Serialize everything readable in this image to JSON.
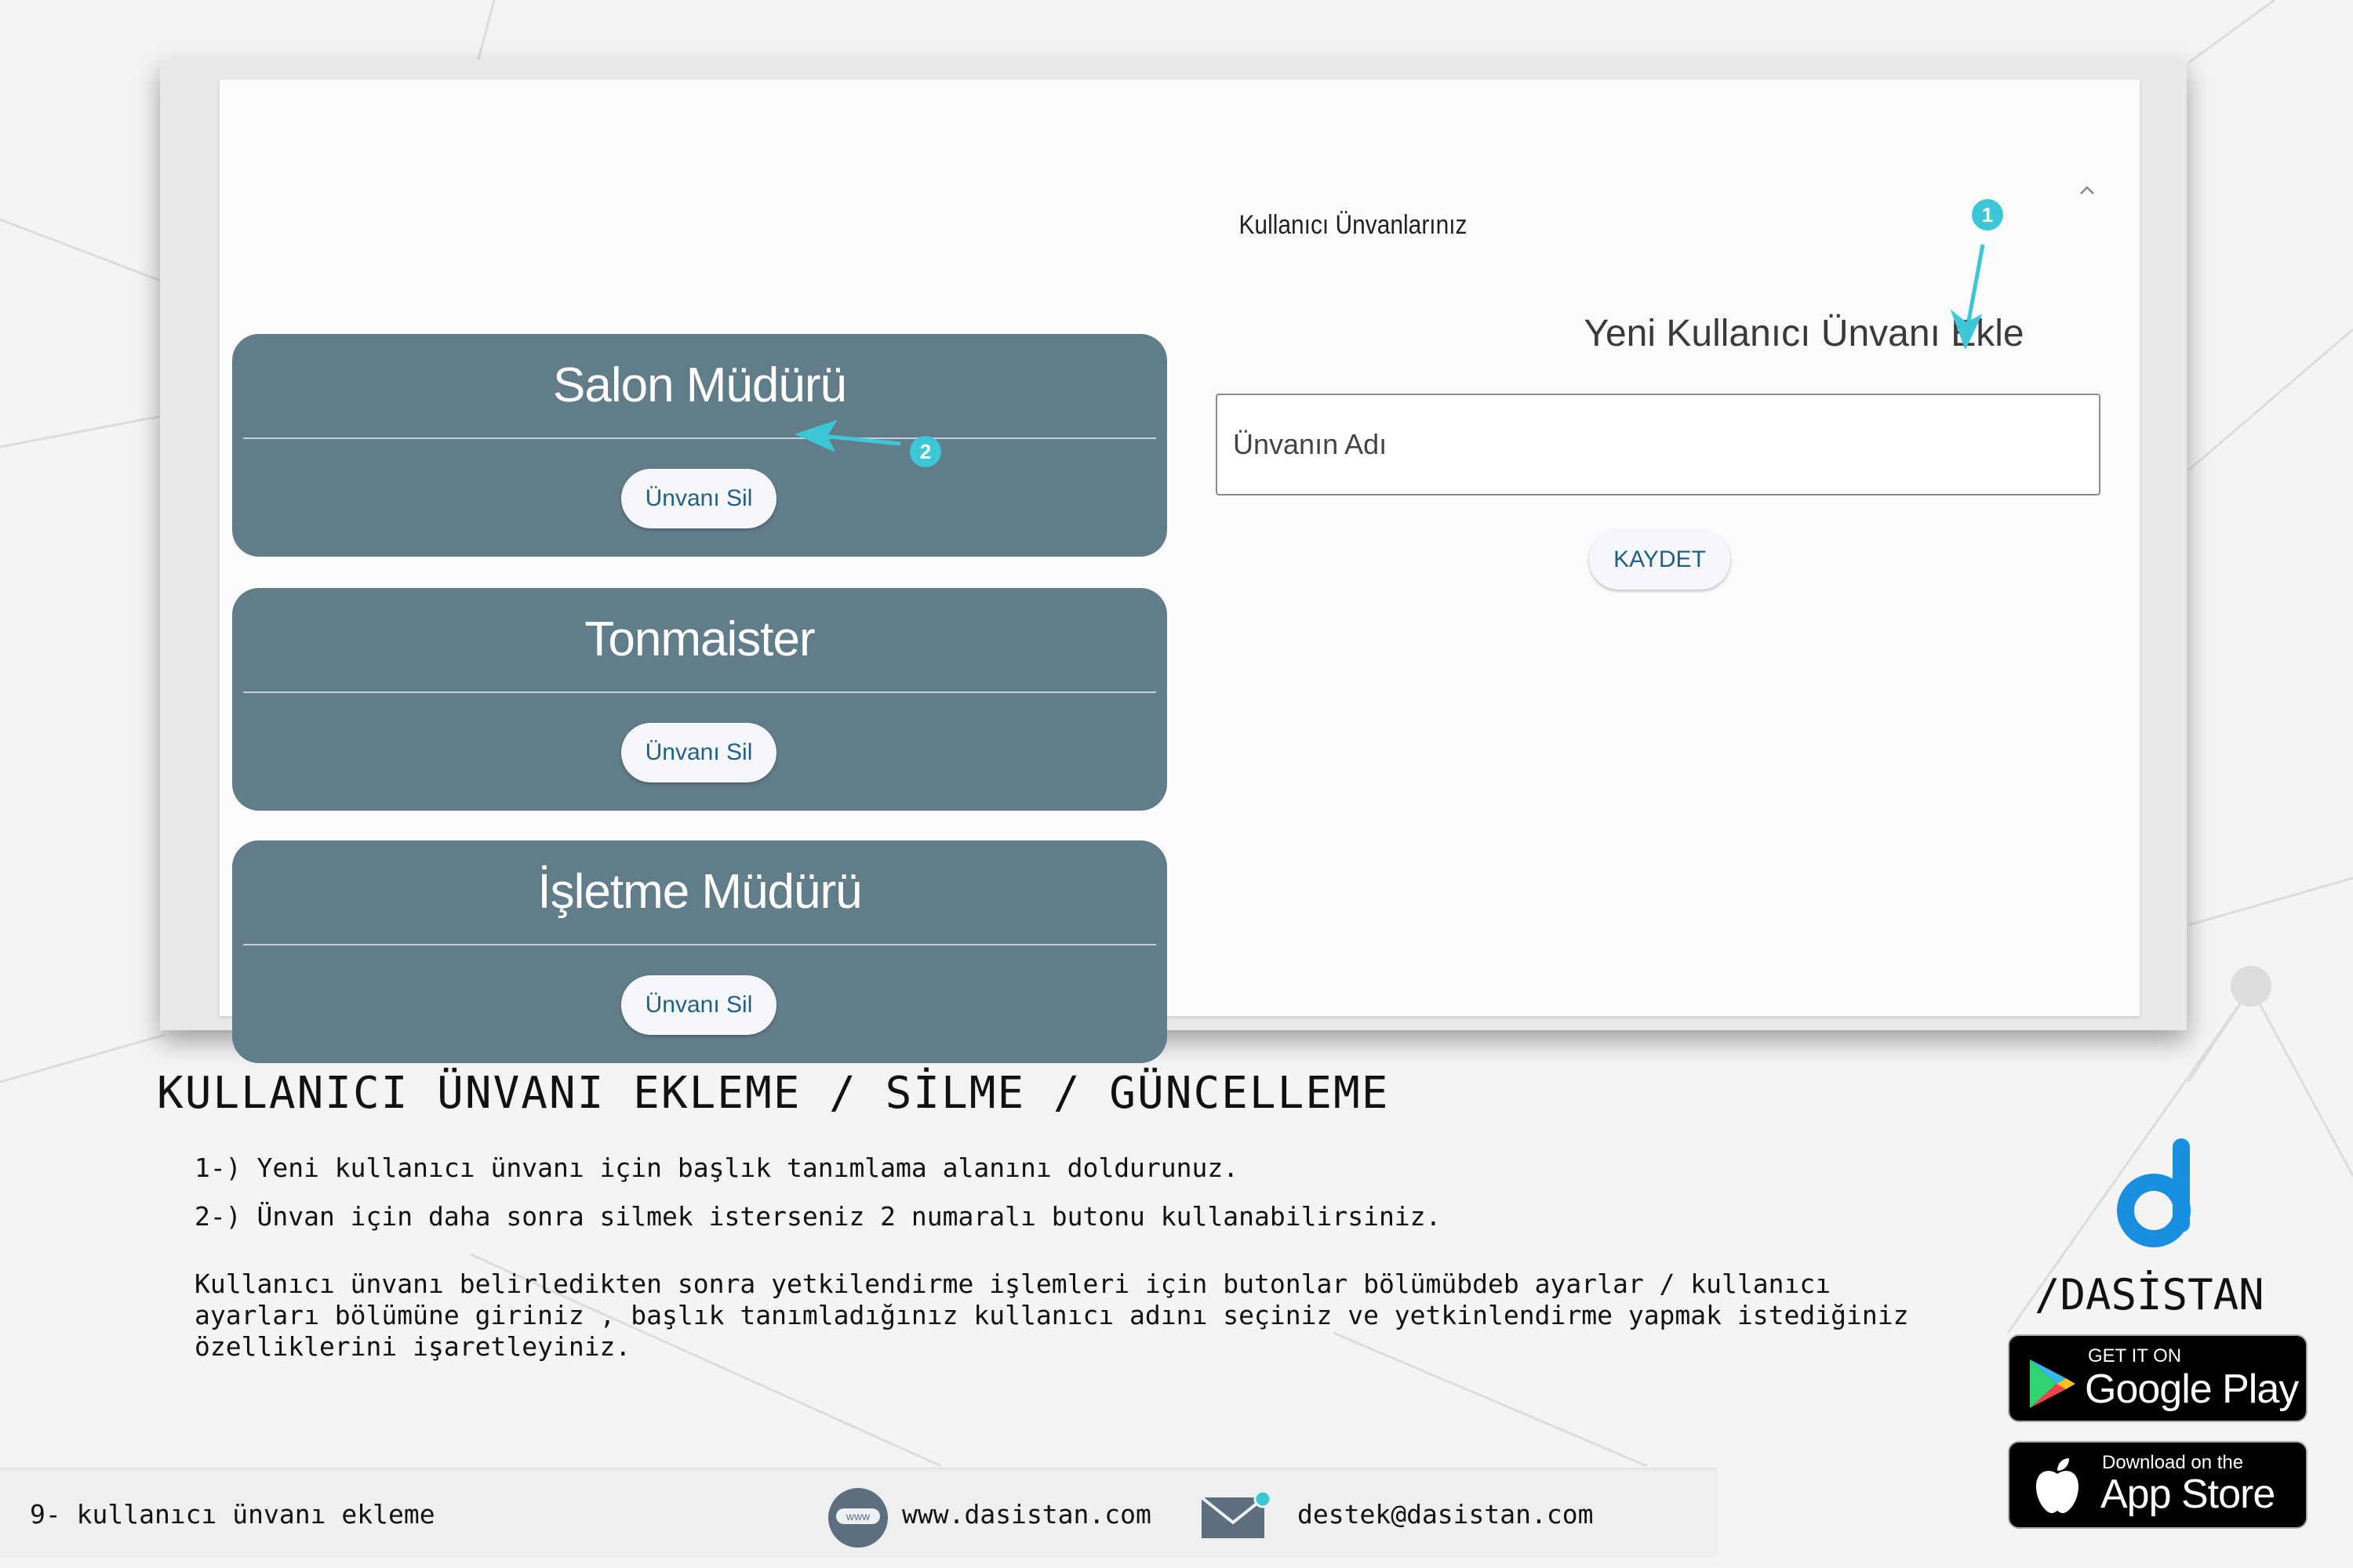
{
  "panel": {
    "title": "Kullanıcı Ünvanlarınız",
    "collapse_icon": "chevron-up-icon"
  },
  "titles": [
    {
      "name": "Salon Müdürü",
      "delete_label": "Ünvanı Sil"
    },
    {
      "name": "Tonmaister",
      "delete_label": "Ünvanı Sil"
    },
    {
      "name": "İşletme Müdürü",
      "delete_label": "Ünvanı Sil"
    }
  ],
  "form": {
    "heading": "Yeni Kullanıcı Ünvanı Ekle",
    "input_placeholder": "Ünvanın Adı",
    "save_label": "KAYDET"
  },
  "annotations": {
    "badge_1": "1",
    "badge_2": "2",
    "color": "#3cc6d6"
  },
  "doc": {
    "heading": "KULLANICI ÜNVANI EKLEME / SİLME / GÜNCELLEME",
    "steps": [
      "1-) Yeni kullanıcı ünvanı için başlık tanımlama alanını doldurunuz.",
      "2-) Ünvan için daha sonra silmek isterseniz 2 numaralı butonu kullanabilirsiniz."
    ],
    "paragraph": "Kullanıcı ünvanı belirledikten sonra yetkilendirme işlemleri için butonlar bölümübdeb ayarlar / kullanıcı\nayarları bölümüne giriniz , başlık tanımladığınız kullanıcı adını seçiniz ve yetkinlendirme yapmak istediğiniz\nözelliklerini işaretleyiniz."
  },
  "brand": {
    "name": "/DASİSTAN",
    "logo_color": "#1a8fe0",
    "google_play_small": "GET IT ON",
    "google_play_big": "Google Play",
    "app_store_small": "Download on the",
    "app_store_big": "App Store"
  },
  "footer": {
    "page_label": "9- kullanıcı ünvanı ekleme",
    "website": "www.dasistan.com",
    "email": "destek@dasistan.com",
    "web_icon_label": "www"
  },
  "colors": {
    "card_bg": "#627d8a",
    "button_text": "#1f5f8a"
  }
}
